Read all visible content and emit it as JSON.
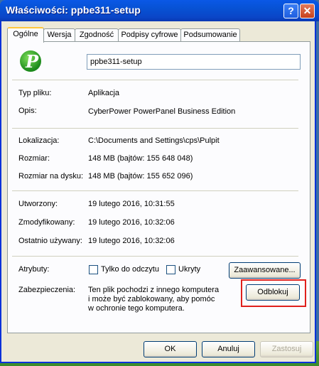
{
  "window": {
    "title": "Właściwości: ppbe311-setup"
  },
  "title_buttons": {
    "help": "?",
    "close": "✕"
  },
  "tabs": [
    {
      "label": "Ogólne",
      "active": true
    },
    {
      "label": "Wersja"
    },
    {
      "label": "Zgodność"
    },
    {
      "label": "Podpisy cyfrowe"
    },
    {
      "label": "Podsumowanie"
    }
  ],
  "file": {
    "icon": "cyberpower-p-icon",
    "name": "ppbe311-setup",
    "type_label": "Typ pliku:",
    "type_value": "Aplikacja",
    "desc_label": "Opis:",
    "desc_value": "CyberPower PowerPanel Business Edition",
    "location_label": "Lokalizacja:",
    "location_value": "C:\\Documents and Settings\\cps\\Pulpit",
    "size_label": "Rozmiar:",
    "size_value": "148 MB (bajtów: 155 648 048)",
    "disk_label": "Rozmiar na dysku:",
    "disk_value": "148 MB (bajtów: 155 652 096)",
    "created_label": "Utworzony:",
    "created_value": "19 lutego 2016, 10:31:55",
    "modified_label": "Zmodyfikowany:",
    "modified_value": "19 lutego 2016, 10:32:06",
    "accessed_label": "Ostatnio używany:",
    "accessed_value": "19 lutego 2016, 10:32:06"
  },
  "attributes": {
    "label": "Atrybuty:",
    "readonly": "Tylko do odczytu",
    "hidden": "Ukryty",
    "advanced_button": "Zaawansowane..."
  },
  "security": {
    "label": "Zabezpieczenia:",
    "line1": "Ten plik pochodzi z innego komputera",
    "line2": "i może być zablokowany, aby pomóc",
    "line3": "w ochronie tego komputera.",
    "unblock_button": "Odblokuj"
  },
  "footer": {
    "ok": "OK",
    "cancel": "Anuluj",
    "apply": "Zastosuj"
  },
  "colors": {
    "highlight": "#e0201c",
    "titlebar": "#0752d4"
  }
}
